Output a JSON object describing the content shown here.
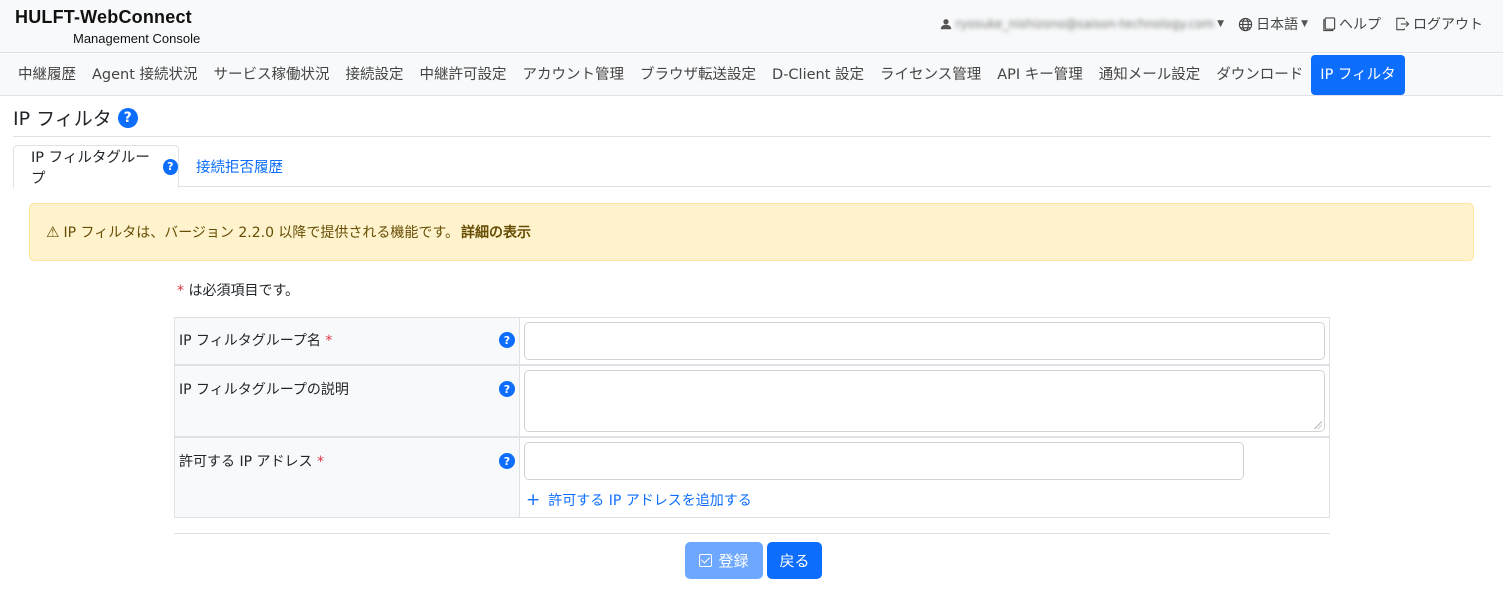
{
  "header": {
    "brand_title": "HULFT-WebConnect",
    "brand_subtitle": "Management Console",
    "user_email": "ryosuke_nishizono@saison-technology.com",
    "language": "日本語",
    "help": "ヘルプ",
    "logout": "ログアウト"
  },
  "nav": {
    "items": [
      {
        "label": "中継履歴"
      },
      {
        "label": "Agent 接続状況"
      },
      {
        "label": "サービス稼働状況"
      },
      {
        "label": "接続設定"
      },
      {
        "label": "中継許可設定"
      },
      {
        "label": "アカウント管理"
      },
      {
        "label": "ブラウザ転送設定"
      },
      {
        "label": "D-Client 設定"
      },
      {
        "label": "ライセンス管理"
      },
      {
        "label": "API キー管理"
      },
      {
        "label": "通知メール設定"
      },
      {
        "label": "ダウンロード"
      },
      {
        "label": "IP フィルタ",
        "active": true
      }
    ]
  },
  "page": {
    "title": "IP フィルタ",
    "help_glyph": "?"
  },
  "subtabs": {
    "group": "IP フィルタグループ",
    "history": "接続拒否履歴"
  },
  "alert": {
    "text": "IP フィルタは、バージョン 2.2.0 以降で提供される機能です。",
    "link": "詳細の表示"
  },
  "form": {
    "required_mark": "*",
    "required_note": "は必須項目です。",
    "name_label": "IP フィルタグループ名",
    "description_label": "IP フィルタグループの説明",
    "allowed_ip_label": "許可する IP アドレス",
    "add_ip_link": "許可する IP アドレスを追加する",
    "name_value": "",
    "description_value": "",
    "allowed_ip_value": ""
  },
  "buttons": {
    "register": "登録",
    "back": "戻る"
  },
  "colors": {
    "primary": "#0d6efd",
    "primary_disabled": "#6ea8fe",
    "alert_bg": "#fff3cd",
    "required": "#dc3545"
  }
}
